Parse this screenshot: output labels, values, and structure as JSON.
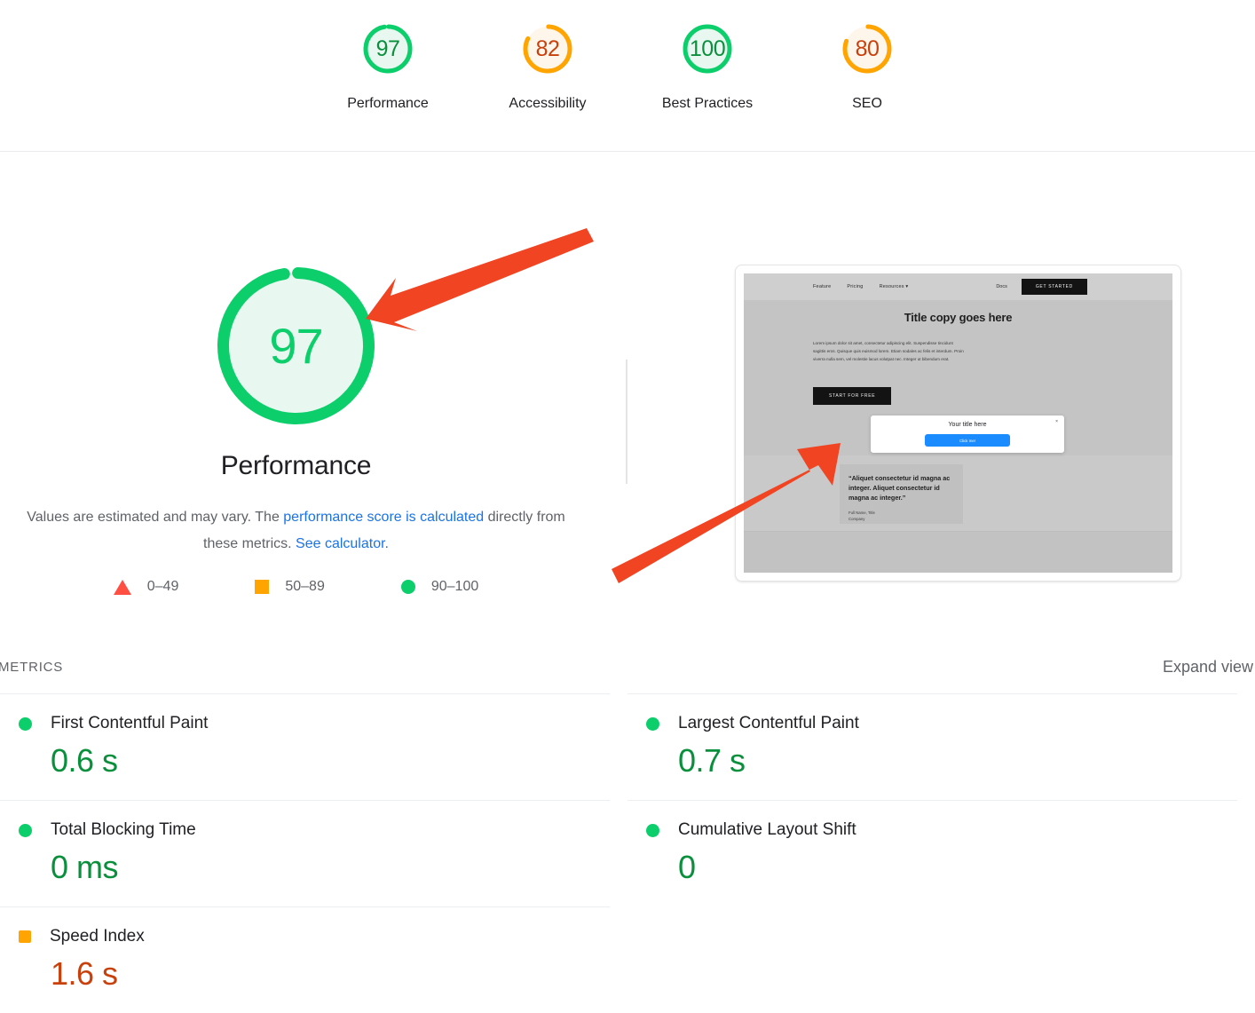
{
  "category_scores": [
    {
      "value": "97",
      "label": "Performance",
      "pct": 97,
      "state": "good"
    },
    {
      "value": "82",
      "label": "Accessibility",
      "pct": 82,
      "state": "average"
    },
    {
      "value": "100",
      "label": "Best Practices",
      "pct": 100,
      "state": "good"
    },
    {
      "value": "80",
      "label": "SEO",
      "pct": 80,
      "state": "average"
    }
  ],
  "main_gauge": {
    "value": "97",
    "title": "Performance",
    "pct": 97
  },
  "description": {
    "lead": "Values are estimated and may vary. The ",
    "link1": "performance score is calculated",
    "middle": " directly from these metrics. ",
    "link2": "See calculator.",
    "full": "Values are estimated and may vary. The performance score is calculated directly from these metrics. See calculator."
  },
  "legend": [
    {
      "shape": "triangle",
      "range": "0–49",
      "color": "#ff4e42"
    },
    {
      "shape": "square",
      "range": "50–89",
      "color": "#ffa400"
    },
    {
      "shape": "circle",
      "range": "90–100",
      "color": "#0cce6b"
    }
  ],
  "metrics_section": {
    "heading": "METRICS",
    "expand_label": "Expand view"
  },
  "metrics": [
    {
      "name": "First Contentful Paint",
      "value": "0.6 s",
      "state": "good",
      "marker": "circle"
    },
    {
      "name": "Largest Contentful Paint",
      "value": "0.7 s",
      "state": "good",
      "marker": "circle"
    },
    {
      "name": "Total Blocking Time",
      "value": "0 ms",
      "state": "good",
      "marker": "circle"
    },
    {
      "name": "Cumulative Layout Shift",
      "value": "0",
      "state": "good",
      "marker": "circle"
    },
    {
      "name": "Speed Index",
      "value": "1.6 s",
      "state": "average",
      "marker": "square"
    }
  ],
  "thumbnail": {
    "nav": [
      "Feature",
      "Pricing",
      "Resources ▾"
    ],
    "nav_docs": "Docs",
    "nav_cta": "GET STARTED",
    "hero_title": "Title copy goes here",
    "hero_paragraph": "Lorem ipsum dolor sit amet, consectetur adipiscing elit. Suspendisse tincidunt sagittis eros. Quisque quis euismod lorem. Etiam sodales ac felis et interdum. Proin viverra nulla sem, vel molestie lacus volutpat nec. Integer ut bibendum erat.",
    "hero_button": "START FOR FREE",
    "quote": "“Aliquet consectetur id magna ac integer. Aliquet consectetur id magna ac integer.”",
    "attribution_name": "Full Name, Title",
    "attribution_company": "Company",
    "modal_title": "Your title here",
    "modal_button": "Click me!",
    "modal_close": "×"
  },
  "annotations": [
    {
      "name": "arrow-to-performance-gauge",
      "color": "#f04422",
      "from": [
        661,
        259
      ],
      "to": [
        414,
        359
      ]
    },
    {
      "name": "arrow-to-page-thumbnail",
      "color": "#f04422",
      "from": [
        690,
        650
      ],
      "to": [
        947,
        500
      ]
    }
  ],
  "colors": {
    "good": "#0cce6b",
    "good_text": "#0a8f3c",
    "average": "#ffa400",
    "average_text": "#c8400b",
    "poor": "#ff4e42",
    "link": "#1a73e8",
    "good_fill": "#e8f8f0",
    "average_fill": "#fef5eb"
  }
}
